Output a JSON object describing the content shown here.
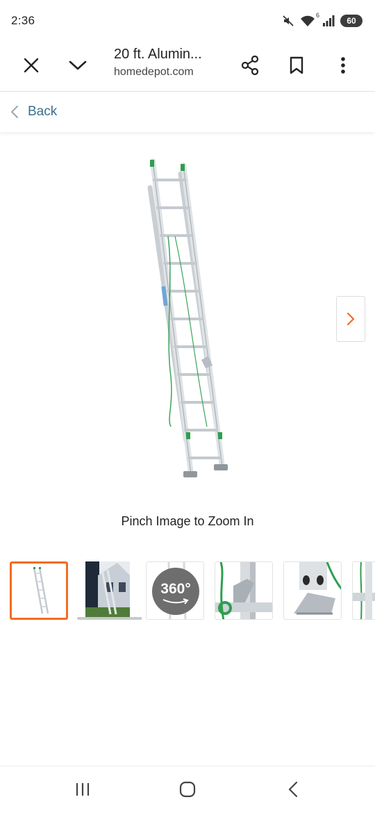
{
  "status": {
    "time": "2:36",
    "battery": "60",
    "network": "6"
  },
  "browser": {
    "title": "20 ft. Alumin...",
    "url": "homedepot.com",
    "icons": {
      "close": "close-icon",
      "collapse": "chevron-down-icon",
      "share": "share-icon",
      "bookmark": "bookmark-icon",
      "menu": "more-vertical-icon"
    }
  },
  "nav": {
    "back_label": "Back"
  },
  "product": {
    "image_alt": "20 ft. Aluminum extension ladder",
    "zoom_hint": "Pinch Image to Zoom In",
    "selected_thumb_index": 0,
    "thumbnails": [
      {
        "kind": "ladder",
        "selected": true
      },
      {
        "kind": "lifestyle-house"
      },
      {
        "kind": "360-view",
        "label": "360°"
      },
      {
        "kind": "rope-pulley-detail"
      },
      {
        "kind": "foot-detail"
      },
      {
        "kind": "partial"
      }
    ]
  },
  "colors": {
    "accent": "#f26c22",
    "link": "#3a6f8f",
    "ladder_green": "#2e9e4f"
  }
}
